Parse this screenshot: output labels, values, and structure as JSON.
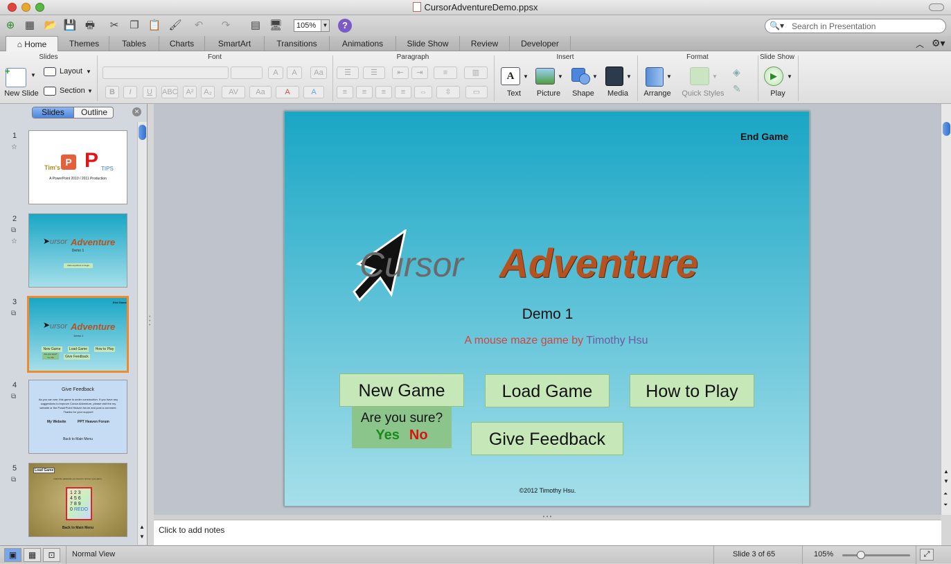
{
  "window": {
    "title": "CursorAdventureDemo.ppsx"
  },
  "toolbar": {
    "zoom": "105%",
    "search_placeholder": "Search in Presentation"
  },
  "tabs": [
    "Home",
    "Themes",
    "Tables",
    "Charts",
    "SmartArt",
    "Transitions",
    "Animations",
    "Slide Show",
    "Review",
    "Developer"
  ],
  "ribbon": {
    "groups": {
      "slides": "Slides",
      "font": "Font",
      "paragraph": "Paragraph",
      "insert": "Insert",
      "format": "Format",
      "slideshow": "Slide Show"
    },
    "new_slide": "New Slide",
    "layout": "Layout",
    "section": "Section",
    "text": "Text",
    "picture": "Picture",
    "shape": "Shape",
    "media": "Media",
    "arrange": "Arrange",
    "quick_styles": "Quick Styles",
    "play": "Play"
  },
  "sidebar": {
    "seg_slides": "Slides",
    "seg_outline": "Outline",
    "thumbs": [
      {
        "num": "1",
        "line1": "Tim's",
        "line2": "TIPS",
        "caption": "A PowerPoint 2010 / 2011 Production"
      },
      {
        "num": "2",
        "title1": "ursor",
        "title2": "Adventure",
        "sub": "Demo 1",
        "button": "Click anywhere to begin"
      },
      {
        "num": "3",
        "title1": "ursor",
        "title2": "Adventure",
        "sub": "Demo 1",
        "end": "End Game",
        "b1": "New Game",
        "b2": "Load Game",
        "b3": "How to Play",
        "b4": "Give Feedback",
        "q": "Are you sure?",
        "yes": "Yes",
        "no": "No"
      },
      {
        "num": "4",
        "title": "Give Feedback",
        "body": "As you can see, this game is under construction. If you have any suggestions to improve Cursor Adventure, please visit the my website or the PowerPoint Heaven forum and post a comment. Thanks for your support!",
        "l1": "My Website",
        "l2": "PPT Heaven Forum",
        "back": "Back to Main Menu"
      },
      {
        "num": "5",
        "title": "Load Game",
        "sub": "Insert the passcode you found to recover your game.",
        "keys": [
          "1",
          "2",
          "3",
          "4",
          "5",
          "6",
          "7",
          "8",
          "9",
          "0",
          "REDO"
        ],
        "back": "Back to Main Menu"
      }
    ]
  },
  "slide": {
    "end_game": "End Game",
    "title_part1": "Cursor",
    "title_part2": "Adventure",
    "subtitle": "Demo 1",
    "tagline_prefix": "A mouse maze game by",
    "tagline_author": "Timothy Hsu",
    "buttons": {
      "new_game": "New Game",
      "load_game": "Load Game",
      "how_to_play": "How to Play",
      "give_feedback": "Give Feedback"
    },
    "confirm": {
      "question": "Are you sure?",
      "yes": "Yes",
      "no": "No"
    },
    "copyright": "©2012 Timothy Hsu.",
    "colors": {
      "adventure": "#b5521f",
      "yes": "#1a8a1a",
      "no": "#d91414",
      "tagline": "#d0453f",
      "author": "#6c5aa3"
    }
  },
  "notes": {
    "placeholder": "Click to add notes"
  },
  "status": {
    "view": "Normal View",
    "slide_pos": "Slide 3 of 65",
    "zoom": "105%"
  }
}
